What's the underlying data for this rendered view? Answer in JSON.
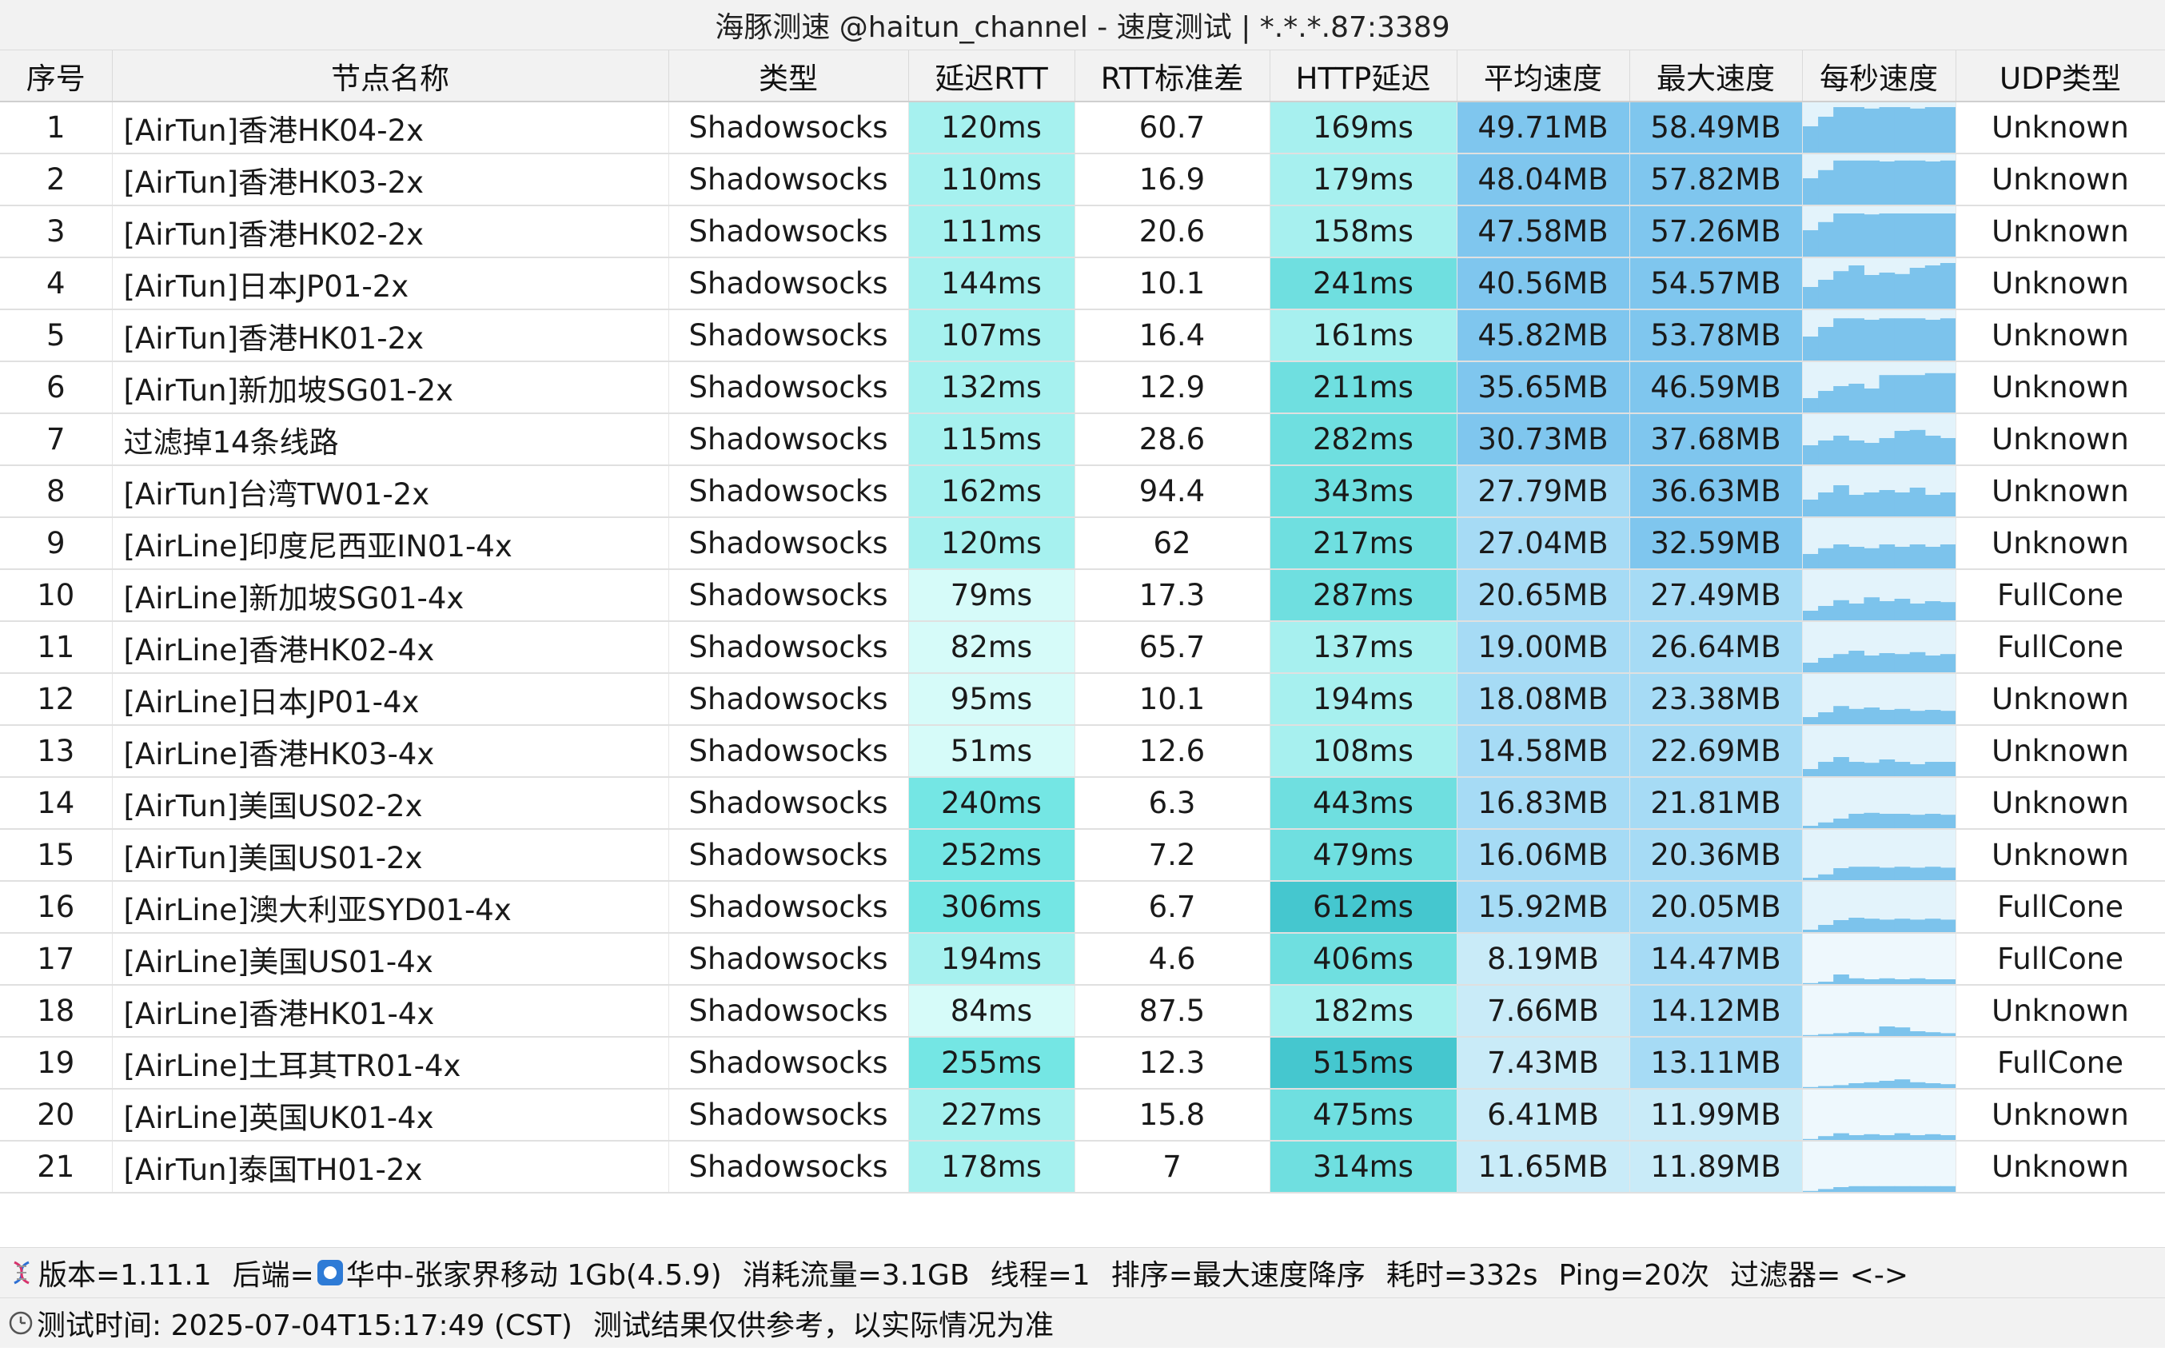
{
  "window": {
    "title": "海豚测速 @haitun_channel - 速度测试 | *.*.*.87:3389"
  },
  "table": {
    "headers": [
      "序号",
      "节点名称",
      "类型",
      "延迟RTT",
      "RTT标准差",
      "HTTP延迟",
      "平均速度",
      "最大速度",
      "每秒速度",
      "UDP类型"
    ],
    "rows": [
      {
        "no": "1",
        "name": "[AirTun]香港HK04-2x",
        "type": "Shadowsocks",
        "rtt": "120ms",
        "rtt_sd": "60.7",
        "http": "169ms",
        "avg": "49.71MB",
        "max": "58.49MB",
        "udp": "Unknown",
        "spark": [
          0.55,
          0.75,
          0.95,
          0.95,
          0.92,
          0.95,
          0.95,
          0.92,
          0.95,
          0.95
        ]
      },
      {
        "no": "2",
        "name": "[AirTun]香港HK03-2x",
        "type": "Shadowsocks",
        "rtt": "110ms",
        "rtt_sd": "16.9",
        "http": "179ms",
        "avg": "48.04MB",
        "max": "57.82MB",
        "udp": "Unknown",
        "spark": [
          0.55,
          0.72,
          0.92,
          0.92,
          0.92,
          0.9,
          0.92,
          0.92,
          0.9,
          0.92
        ]
      },
      {
        "no": "3",
        "name": "[AirTun]香港HK02-2x",
        "type": "Shadowsocks",
        "rtt": "111ms",
        "rtt_sd": "20.6",
        "http": "158ms",
        "avg": "47.58MB",
        "max": "57.26MB",
        "udp": "Unknown",
        "spark": [
          0.55,
          0.72,
          0.9,
          0.9,
          0.88,
          0.9,
          0.9,
          0.9,
          0.9,
          0.9
        ]
      },
      {
        "no": "4",
        "name": "[AirTun]日本JP01-2x",
        "type": "Shadowsocks",
        "rtt": "144ms",
        "rtt_sd": "10.1",
        "http": "241ms",
        "avg": "40.56MB",
        "max": "54.57MB",
        "udp": "Unknown",
        "spark": [
          0.45,
          0.6,
          0.78,
          0.9,
          0.7,
          0.75,
          0.72,
          0.85,
          0.9,
          0.95
        ]
      },
      {
        "no": "5",
        "name": "[AirTun]香港HK01-2x",
        "type": "Shadowsocks",
        "rtt": "107ms",
        "rtt_sd": "16.4",
        "http": "161ms",
        "avg": "45.82MB",
        "max": "53.78MB",
        "udp": "Unknown",
        "spark": [
          0.5,
          0.7,
          0.88,
          0.88,
          0.85,
          0.88,
          0.88,
          0.88,
          0.85,
          0.88
        ]
      },
      {
        "no": "6",
        "name": "[AirTun]新加坡SG01-2x",
        "type": "Shadowsocks",
        "rtt": "132ms",
        "rtt_sd": "12.9",
        "http": "211ms",
        "avg": "35.65MB",
        "max": "46.59MB",
        "udp": "Unknown",
        "spark": [
          0.3,
          0.45,
          0.55,
          0.6,
          0.5,
          0.78,
          0.78,
          0.78,
          0.82,
          0.82
        ]
      },
      {
        "no": "7",
        "name": "过滤掉14条线路",
        "type": "Shadowsocks",
        "rtt": "115ms",
        "rtt_sd": "28.6",
        "http": "282ms",
        "avg": "30.73MB",
        "max": "37.68MB",
        "udp": "Unknown",
        "spark": [
          0.4,
          0.5,
          0.6,
          0.5,
          0.45,
          0.55,
          0.7,
          0.72,
          0.6,
          0.55
        ]
      },
      {
        "no": "8",
        "name": "[AirTun]台湾TW01-2x",
        "type": "Shadowsocks",
        "rtt": "162ms",
        "rtt_sd": "94.4",
        "http": "343ms",
        "avg": "27.79MB",
        "max": "36.63MB",
        "udp": "Unknown",
        "spark": [
          0.35,
          0.5,
          0.65,
          0.45,
          0.5,
          0.55,
          0.5,
          0.6,
          0.45,
          0.5
        ]
      },
      {
        "no": "9",
        "name": "[AirLine]印度尼西亚IN01-4x",
        "type": "Shadowsocks",
        "rtt": "120ms",
        "rtt_sd": "62",
        "http": "217ms",
        "avg": "27.04MB",
        "max": "32.59MB",
        "udp": "Unknown",
        "spark": [
          0.3,
          0.42,
          0.5,
          0.45,
          0.42,
          0.5,
          0.45,
          0.5,
          0.45,
          0.5
        ]
      },
      {
        "no": "10",
        "name": "[AirLine]新加坡SG01-4x",
        "type": "Shadowsocks",
        "rtt": "79ms",
        "rtt_sd": "17.3",
        "http": "287ms",
        "avg": "20.65MB",
        "max": "27.49MB",
        "udp": "FullCone",
        "spark": [
          0.2,
          0.3,
          0.42,
          0.35,
          0.48,
          0.4,
          0.45,
          0.35,
          0.4,
          0.38
        ]
      },
      {
        "no": "11",
        "name": "[AirLine]香港HK02-4x",
        "type": "Shadowsocks",
        "rtt": "82ms",
        "rtt_sd": "65.7",
        "http": "137ms",
        "avg": "19.00MB",
        "max": "26.64MB",
        "udp": "FullCone",
        "spark": [
          0.2,
          0.3,
          0.38,
          0.45,
          0.35,
          0.4,
          0.38,
          0.42,
          0.35,
          0.38
        ]
      },
      {
        "no": "12",
        "name": "[AirLine]日本JP01-4x",
        "type": "Shadowsocks",
        "rtt": "95ms",
        "rtt_sd": "10.1",
        "http": "194ms",
        "avg": "18.08MB",
        "max": "23.38MB",
        "udp": "Unknown",
        "spark": [
          0.15,
          0.25,
          0.38,
          0.32,
          0.35,
          0.3,
          0.32,
          0.28,
          0.3,
          0.28
        ]
      },
      {
        "no": "13",
        "name": "[AirLine]香港HK03-4x",
        "type": "Shadowsocks",
        "rtt": "51ms",
        "rtt_sd": "12.6",
        "http": "108ms",
        "avg": "14.58MB",
        "max": "22.69MB",
        "udp": "Unknown",
        "spark": [
          0.15,
          0.3,
          0.4,
          0.3,
          0.28,
          0.35,
          0.3,
          0.25,
          0.3,
          0.3
        ]
      },
      {
        "no": "14",
        "name": "[AirTun]美国US02-2x",
        "type": "Shadowsocks",
        "rtt": "240ms",
        "rtt_sd": "6.3",
        "http": "443ms",
        "avg": "16.83MB",
        "max": "21.81MB",
        "udp": "Unknown",
        "spark": [
          0.05,
          0.12,
          0.2,
          0.3,
          0.32,
          0.3,
          0.3,
          0.28,
          0.3,
          0.28
        ]
      },
      {
        "no": "15",
        "name": "[AirTun]美国US01-2x",
        "type": "Shadowsocks",
        "rtt": "252ms",
        "rtt_sd": "7.2",
        "http": "479ms",
        "avg": "16.06MB",
        "max": "20.36MB",
        "udp": "Unknown",
        "spark": [
          0.05,
          0.12,
          0.25,
          0.28,
          0.28,
          0.26,
          0.28,
          0.26,
          0.28,
          0.26
        ]
      },
      {
        "no": "16",
        "name": "[AirLine]澳大利亚SYD01-4x",
        "type": "Shadowsocks",
        "rtt": "306ms",
        "rtt_sd": "6.7",
        "http": "612ms",
        "avg": "15.92MB",
        "max": "20.05MB",
        "udp": "FullCone",
        "spark": [
          0.05,
          0.15,
          0.25,
          0.3,
          0.28,
          0.26,
          0.28,
          0.26,
          0.28,
          0.26
        ]
      },
      {
        "no": "17",
        "name": "[AirLine]美国US01-4x",
        "type": "Shadowsocks",
        "rtt": "194ms",
        "rtt_sd": "4.6",
        "http": "406ms",
        "avg": "8.19MB",
        "max": "14.47MB",
        "udp": "FullCone",
        "spark": [
          0.02,
          0.05,
          0.2,
          0.12,
          0.1,
          0.12,
          0.1,
          0.12,
          0.1,
          0.1
        ]
      },
      {
        "no": "18",
        "name": "[AirLine]香港HK01-4x",
        "type": "Shadowsocks",
        "rtt": "84ms",
        "rtt_sd": "87.5",
        "http": "182ms",
        "avg": "7.66MB",
        "max": "14.12MB",
        "udp": "Unknown",
        "spark": [
          0.02,
          0.04,
          0.06,
          0.08,
          0.06,
          0.2,
          0.18,
          0.1,
          0.08,
          0.06
        ]
      },
      {
        "no": "19",
        "name": "[AirLine]土耳其TR01-4x",
        "type": "Shadowsocks",
        "rtt": "255ms",
        "rtt_sd": "12.3",
        "http": "515ms",
        "avg": "7.43MB",
        "max": "13.11MB",
        "udp": "FullCone",
        "spark": [
          0.02,
          0.04,
          0.06,
          0.1,
          0.12,
          0.15,
          0.18,
          0.12,
          0.1,
          0.08
        ]
      },
      {
        "no": "20",
        "name": "[AirLine]英国UK01-4x",
        "type": "Shadowsocks",
        "rtt": "227ms",
        "rtt_sd": "15.8",
        "http": "475ms",
        "avg": "6.41MB",
        "max": "11.99MB",
        "udp": "Unknown",
        "spark": [
          0.02,
          0.08,
          0.14,
          0.1,
          0.12,
          0.1,
          0.14,
          0.1,
          0.12,
          0.1
        ]
      },
      {
        "no": "21",
        "name": "[AirTun]泰国TH01-2x",
        "type": "Shadowsocks",
        "rtt": "178ms",
        "rtt_sd": "7",
        "http": "314ms",
        "avg": "11.65MB",
        "max": "11.89MB",
        "udp": "Unknown",
        "spark": [
          0.02,
          0.06,
          0.1,
          0.12,
          0.12,
          0.12,
          0.12,
          0.12,
          0.12,
          0.12
        ]
      }
    ]
  },
  "footer": {
    "version": "版本=1.11.1",
    "backend_label": "后端=",
    "backend_value": "华中-张家界移动 1Gb(4.5.9)",
    "traffic": "消耗流量=3.1GB",
    "threads": "线程=1",
    "sort": "排序=最大速度降序",
    "elapsed": "耗时=332s",
    "ping": "Ping=20次",
    "filter": "过滤器= <->",
    "test_time": "测试时间: 2025-07-04T15:17:49 (CST)",
    "disclaimer": "测试结果仅供参考，以实际情况为准"
  },
  "icons": {
    "footer_left": "dna-icon",
    "backend": "backend-logo-icon",
    "clock": "clock-icon"
  },
  "colors": {
    "rtt_low": "#d6fbf9",
    "rtt_mid": "#a6f1ef",
    "rtt_high": "#74e6e4",
    "http_low": "#a7f0ef",
    "http_mid": "#6fdfe0",
    "http_high": "#45c7cf",
    "speed_light": "#c9ebf8",
    "speed_mid": "#a6dbf5",
    "speed_dark": "#7fc6ee",
    "spark_bar": "#7cc3ec"
  }
}
